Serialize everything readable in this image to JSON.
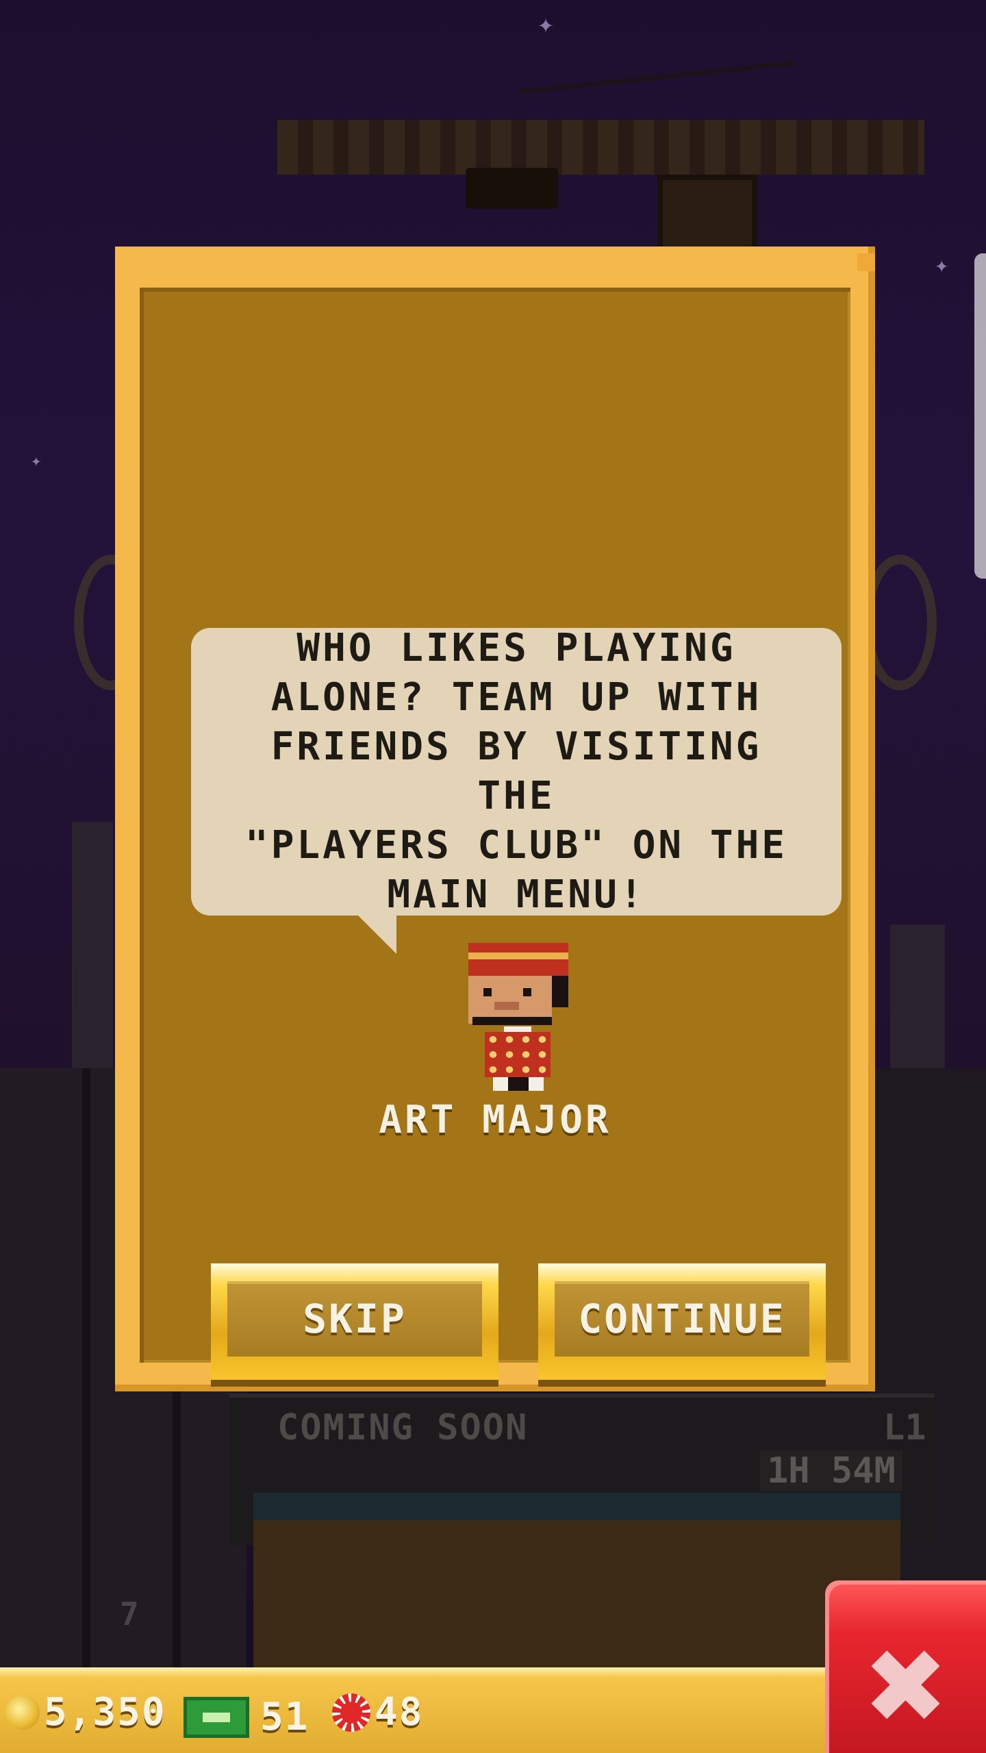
{
  "dialog": {
    "message": "WHO LIKES PLAYING\nALONE? TEAM UP WITH\nFRIENDS BY VISITING THE\n\"PLAYERS CLUB\" ON THE\nMAIN MENU!",
    "character_name": "ART MAJOR",
    "skip_label": "SKIP",
    "continue_label": "CONTINUE"
  },
  "background_floor": {
    "title": "COMING SOON",
    "level": "L1",
    "timer": "1H 54M",
    "floor_number": "7"
  },
  "bottom_bar": {
    "coins": "5,350",
    "bux": "51",
    "chips": "48"
  },
  "colors": {
    "dialog_border": "#f5b84a",
    "dialog_fill": "#a37516",
    "bubble": "#e3d4b7",
    "close_button": "#e8262f"
  },
  "icons": {
    "coin": "coin-icon",
    "bux": "bux-icon",
    "chip": "chip-icon",
    "close": "close-icon"
  }
}
